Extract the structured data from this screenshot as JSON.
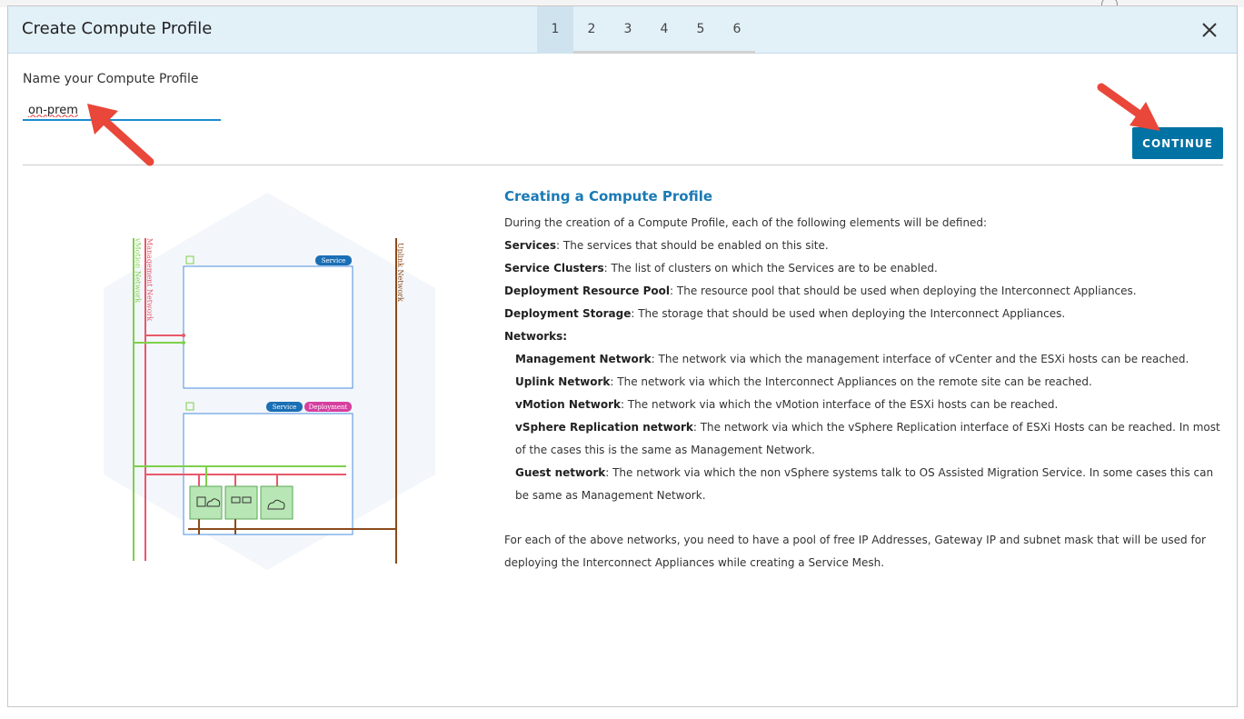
{
  "dialog": {
    "title": "Create Compute Profile",
    "steps": [
      "1",
      "2",
      "3",
      "4",
      "5",
      "6"
    ],
    "active_step": "1"
  },
  "form": {
    "name_label": "Name your Compute Profile",
    "name_value": "on-prem",
    "continue_label": "CONTINUE"
  },
  "diagram": {
    "vmotion_label": "vMotion Network",
    "management_label": "Management Network",
    "uplink_label": "Uplink Network",
    "badge_service": "Service",
    "badge_deployment": "Deployment"
  },
  "info": {
    "heading": "Creating a Compute Profile",
    "intro": "During the creation of a Compute Profile, each of the following elements will be defined:",
    "items": [
      {
        "term": "Services",
        "desc": ": The services that should be enabled on this site."
      },
      {
        "term": "Service Clusters",
        "desc": ": The list of clusters on which the Services are to be enabled."
      },
      {
        "term": "Deployment Resource Pool",
        "desc": ": The resource pool that should be used when deploying the Interconnect Appliances."
      },
      {
        "term": "Deployment Storage",
        "desc": ": The storage that should be used when deploying the Interconnect Appliances."
      }
    ],
    "networks_heading": "Networks:",
    "networks": [
      {
        "term": "Management Network",
        "desc": ": The network via which the management interface of vCenter and the ESXi hosts can be reached."
      },
      {
        "term": "Uplink Network",
        "desc": ": The network via which the Interconnect Appliances on the remote site can be reached."
      },
      {
        "term": "vMotion Network",
        "desc": ": The network via which the vMotion interface of the ESXi hosts can be reached."
      },
      {
        "term": "vSphere Replication network",
        "desc": ": The network via which the vSphere Replication interface of ESXi Hosts can be reached. In most of the cases this is the same as Management Network."
      },
      {
        "term": "Guest network",
        "desc": ": The network via which the non vSphere systems talk to OS Assisted Migration Service. In some cases this can be same as Management Network."
      }
    ],
    "footer": "For each of the above networks, you need to have a pool of free IP Addresses, Gateway IP and subnet mask that will be used for deploying the Interconnect Appliances while creating a Service Mesh."
  },
  "colors": {
    "header_bg": "#e2f0f8",
    "accent": "#0072a3",
    "heading": "#1a7ab5",
    "vmotion": "#7ed04b",
    "management": "#e8586b",
    "uplink": "#8b4a1c",
    "callout_arrow": "#e8473a"
  }
}
